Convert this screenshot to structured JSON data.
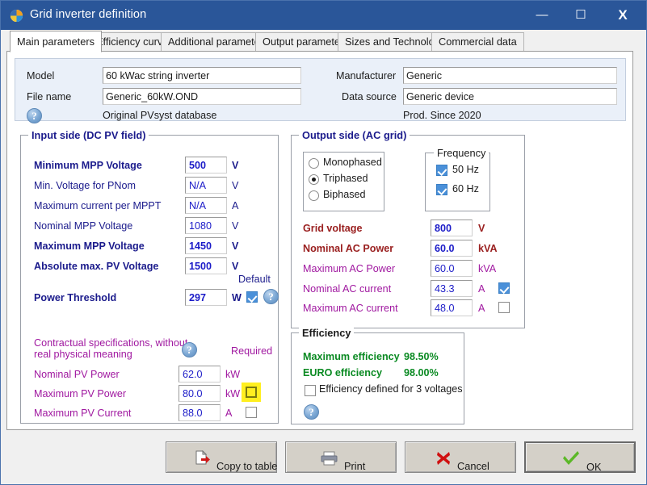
{
  "window": {
    "title": "Grid inverter definition",
    "icon": "pvsyst-logo-icon",
    "minimize": "—",
    "maximize": "☐",
    "close": "X"
  },
  "tabs": [
    {
      "label": "Main parameters",
      "active": true
    },
    {
      "label": "Efficiency curve",
      "active": false
    },
    {
      "label": "Additional parameters",
      "active": false
    },
    {
      "label": "Output parameters",
      "active": false
    },
    {
      "label": "Sizes and Technology",
      "active": false
    },
    {
      "label": "Commercial data",
      "active": false
    }
  ],
  "header": {
    "model_label": "Model",
    "model_value": "60 kWac string inverter",
    "filename_label": "File name",
    "filename_value": "Generic_60kW.OND",
    "database_note": "Original PVsyst database",
    "manufacturer_label": "Manufacturer",
    "manufacturer_value": "Generic",
    "datasource_label": "Data source",
    "datasource_value": "Generic device",
    "prod_since": "Prod. Since 2020",
    "help": "?"
  },
  "input_side": {
    "title": "Input side (DC PV field)",
    "rows": [
      {
        "label": "Minimum MPP Voltage",
        "value": "500",
        "unit": "V",
        "bold": true
      },
      {
        "label": "Min. Voltage for PNom",
        "value": "N/A",
        "unit": "V",
        "bold": false
      },
      {
        "label": "Maximum current per MPPT",
        "value": "N/A",
        "unit": "A",
        "bold": false
      },
      {
        "label": "Nominal MPP Voltage",
        "value": "1080",
        "unit": "V",
        "bold": false
      },
      {
        "label": "Maximum MPP Voltage",
        "value": "1450",
        "unit": "V",
        "bold": true
      },
      {
        "label": "Absolute max. PV Voltage",
        "value": "1500",
        "unit": "V",
        "bold": true
      }
    ],
    "default_caption": "Default",
    "power_threshold": {
      "label": "Power Threshold",
      "value": "297",
      "unit": "W",
      "default_checked": true,
      "help": "?"
    },
    "contractual": {
      "note_line1": "Contractual specifications, without",
      "note_line2": "real physical meaning",
      "help": "?",
      "required_caption": "Required",
      "rows": [
        {
          "label": "Nominal PV Power",
          "value": "62.0",
          "unit": "kW",
          "has_checkbox": false,
          "checked": false,
          "highlight": false
        },
        {
          "label": "Maximum PV Power",
          "value": "80.0",
          "unit": "kW",
          "has_checkbox": true,
          "checked": false,
          "highlight": true
        },
        {
          "label": "Maximum PV Current",
          "value": "88.0",
          "unit": "A",
          "has_checkbox": true,
          "checked": false,
          "highlight": false
        }
      ]
    }
  },
  "output_side": {
    "title": "Output side (AC grid)",
    "phase_options": [
      {
        "label": "Monophased",
        "selected": false
      },
      {
        "label": "Triphased",
        "selected": true
      },
      {
        "label": "Biphased",
        "selected": false
      }
    ],
    "frequency": {
      "title": "Frequency",
      "options": [
        {
          "label": "50 Hz",
          "checked": true
        },
        {
          "label": "60 Hz",
          "checked": true
        }
      ]
    },
    "rows": [
      {
        "label": "Grid voltage",
        "value": "800",
        "unit": "V",
        "bold": true,
        "color": "maroon",
        "has_checkbox": false,
        "checked": false
      },
      {
        "label": "Nominal AC Power",
        "value": "60.0",
        "unit": "kVA",
        "bold": true,
        "color": "maroon",
        "has_checkbox": false,
        "checked": false
      },
      {
        "label": "Maximum AC Power",
        "value": "60.0",
        "unit": "kVA",
        "bold": false,
        "color": "purple",
        "has_checkbox": false,
        "checked": false
      },
      {
        "label": "Nominal AC current",
        "value": "43.3",
        "unit": "A",
        "bold": false,
        "color": "purple",
        "has_checkbox": true,
        "checked": true
      },
      {
        "label": "Maximum AC current",
        "value": "48.0",
        "unit": "A",
        "bold": false,
        "color": "purple",
        "has_checkbox": true,
        "checked": false
      }
    ]
  },
  "efficiency": {
    "title": "Efficiency",
    "rows": [
      {
        "label": "Maximum efficiency",
        "value": "98.50%"
      },
      {
        "label": "EURO efficiency",
        "value": "98.00%"
      }
    ],
    "three_voltages": {
      "label": "Efficiency defined for 3 voltages",
      "checked": false
    },
    "help": "?"
  },
  "buttons": [
    {
      "label": "Copy to table",
      "icon": "copy-to-table-icon",
      "default": false
    },
    {
      "label": "Print",
      "icon": "printer-icon",
      "default": false
    },
    {
      "label": "Cancel",
      "icon": "red-x-icon",
      "default": false
    },
    {
      "label": "OK",
      "icon": "green-check-icon",
      "default": true
    }
  ]
}
